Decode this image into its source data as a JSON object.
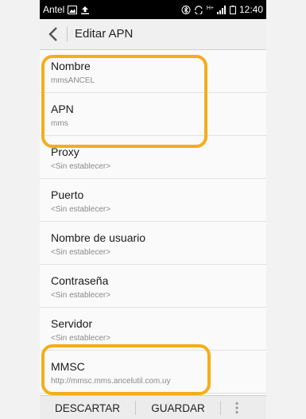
{
  "status_bar": {
    "carrier": "Antel",
    "time": "12:40",
    "network": "H+"
  },
  "header": {
    "title": "Editar APN"
  },
  "apn_fields": [
    {
      "label": "Nombre",
      "value": "mmsANCEL"
    },
    {
      "label": "APN",
      "value": "mms"
    },
    {
      "label": "Proxy",
      "value": "<Sin establecer>"
    },
    {
      "label": "Puerto",
      "value": "<Sin establecer>"
    },
    {
      "label": "Nombre de usuario",
      "value": "<Sin establecer>"
    },
    {
      "label": "Contraseña",
      "value": "<Sin establecer>"
    },
    {
      "label": "Servidor",
      "value": "<Sin establecer>"
    },
    {
      "label": "MMSC",
      "value": "http://mmsc.mms.ancelutil.com.uy"
    }
  ],
  "bottom_bar": {
    "discard_label": "DESCARTAR",
    "save_label": "GUARDAR"
  },
  "colors": {
    "highlight": "#f5ad1a",
    "status_bar": "#000000",
    "background": "#fafafa"
  },
  "icons": [
    "image-icon",
    "upload-icon",
    "bluetooth-icon",
    "rotate-icon",
    "signal-icon",
    "battery-icon",
    "back-arrow-icon",
    "overflow-menu-icon"
  ]
}
